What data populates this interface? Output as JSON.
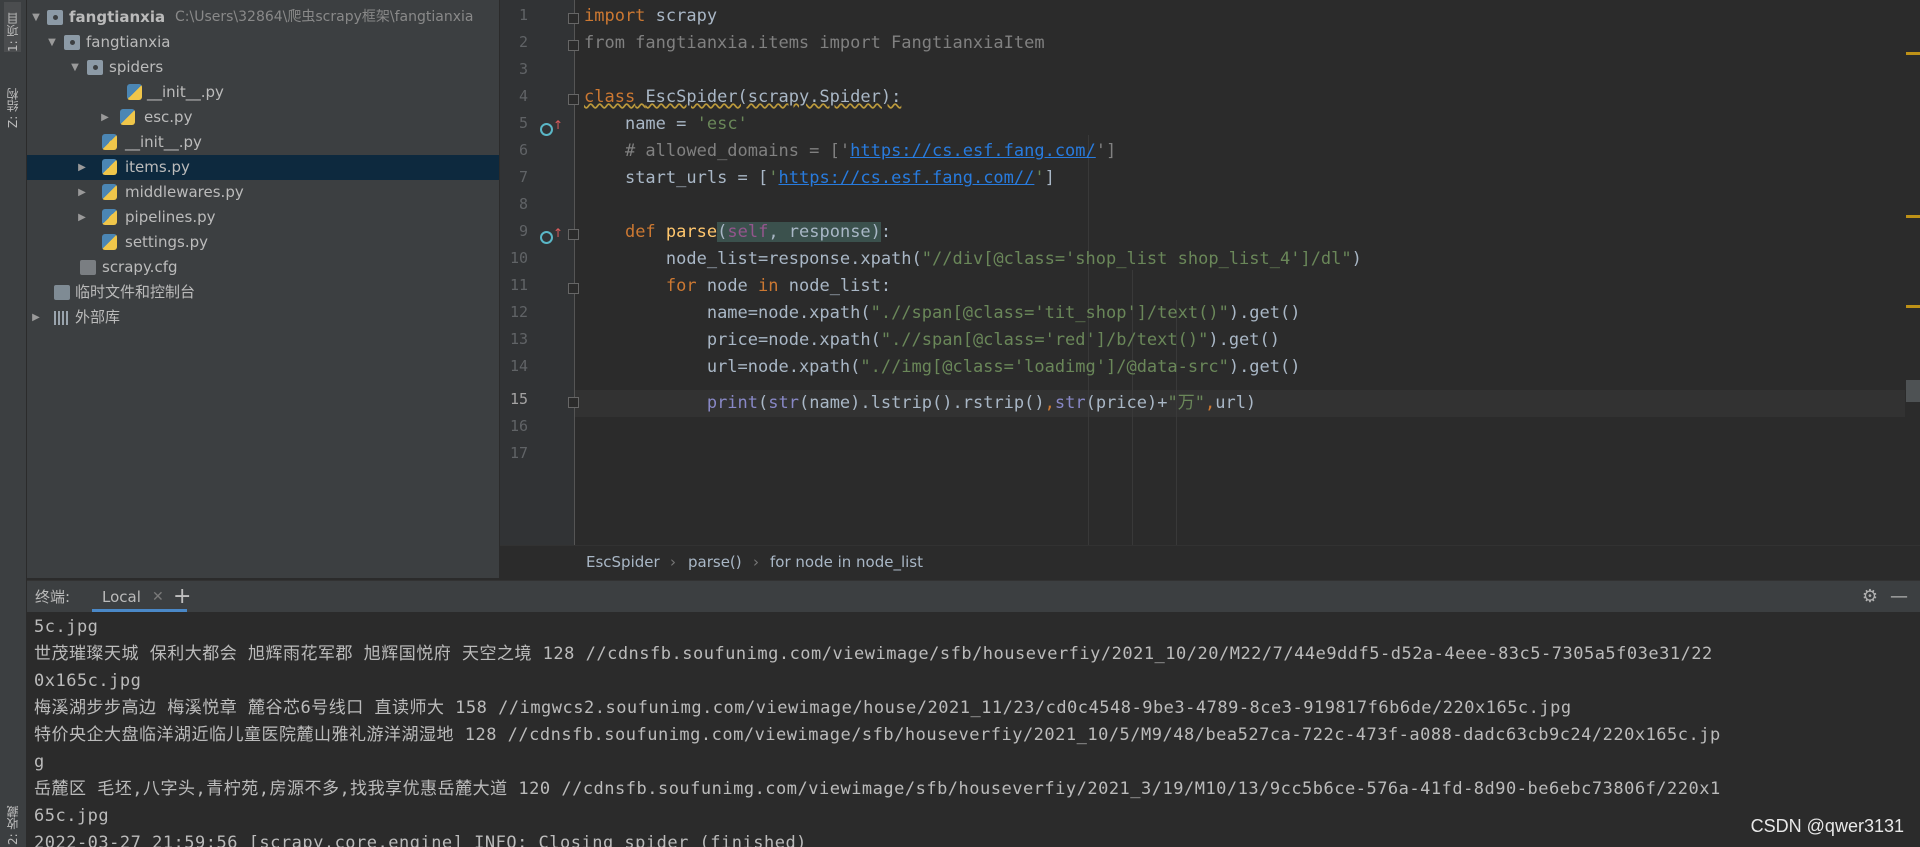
{
  "toolstrip": {
    "project_tab": "1: 项目",
    "structure_tab": "Z: 结构",
    "favorites_tab": "2: 收藏"
  },
  "project": {
    "root": {
      "name": "fangtianxia",
      "path": "C:\\Users\\32864\\爬虫scrapy框架\\fangtianxia"
    },
    "items": [
      {
        "label": "fangtianxia"
      },
      {
        "label": "spiders"
      },
      {
        "label": "__init__.py"
      },
      {
        "label": "esc.py"
      },
      {
        "label": "__init__.py"
      },
      {
        "label": "items.py"
      },
      {
        "label": "middlewares.py"
      },
      {
        "label": "pipelines.py"
      },
      {
        "label": "settings.py"
      },
      {
        "label": "scrapy.cfg"
      },
      {
        "label": "临时文件和控制台"
      },
      {
        "label": "外部库"
      }
    ]
  },
  "editor": {
    "line_numbers": [
      "1",
      "2",
      "3",
      "4",
      "5",
      "6",
      "7",
      "8",
      "9",
      "10",
      "11",
      "12",
      "13",
      "14",
      "15",
      "16",
      "17"
    ],
    "current_line": "15",
    "code": {
      "l1_kw": "import",
      "l1_rest": " scrapy",
      "l2": "from fangtianxia.items import FangtianxiaItem",
      "l4_kw": "class",
      "l4_name": "EscSpider(scrapy.Spider):",
      "l5_a": "name = ",
      "l5_s": "'esc'",
      "l6_a": "# allowed_domains = ['",
      "l6_u": "https://cs.esf.fang.com/",
      "l6_b": "']",
      "l7_a": "start_urls = [",
      "l7_q1": "'",
      "l7_u": "https://cs.esf.fang.com//",
      "l7_q2": "'",
      "l7_b": "]",
      "l9_kw": "def",
      "l9_fn": "parse",
      "l9_p1": "(",
      "l9_self": "self",
      "l9_p2": ", response)",
      "l9_end": ":",
      "l10_a": "node_list=response.xpath(",
      "l10_s": "\"//div[@class='shop_list shop_list_4']/dl\"",
      "l10_b": ")",
      "l11_kw1": "for",
      "l11_a": " node ",
      "l11_kw2": "in",
      "l11_b": " node_list:",
      "l12_a": "name=node.xpath(",
      "l12_s": "\".//span[@class='tit_shop']/text()\"",
      "l12_b": ").get()",
      "l13_a": "price=node.xpath(",
      "l13_s": "\".//span[@class='red']/b/text()\"",
      "l13_b": ").get()",
      "l14_a": "url=node.xpath(",
      "l14_s": "\".//img[@class='loadimg']/@data-src\"",
      "l14_b": ").get()",
      "l15_print": "print",
      "l15_a": "(",
      "l15_str1": "str",
      "l15_b": "(name).lstrip().rstrip()",
      "l15_c1": ",",
      "l15_str2": "str",
      "l15_c": "(price)+",
      "l15_s": "\"万\"",
      "l15_c2": ",",
      "l15_d": "url)"
    },
    "breadcrumb": [
      "EscSpider",
      "parse()",
      "for node in node_list"
    ]
  },
  "terminal": {
    "title": "终端:",
    "tab": "Local",
    "lines": [
      "5c.jpg",
      "世茂璀璨天城 保利大都会 旭辉雨花军郡 旭辉国悦府 天空之境 128 //cdnsfb.soufunimg.com/viewimage/sfb/houseverfiy/2021_10/20/M22/7/44e9ddf5-d52a-4eee-83c5-7305a5f03e31/22",
      "0x165c.jpg",
      "梅溪湖步步高边 梅溪悦章 麓谷芯6号线口 直读师大 158 //imgwcs2.soufunimg.com/viewimage/house/2021_11/23/cd0c4548-9be3-4789-8ce3-919817f6b6de/220x165c.jpg",
      "特价央企大盘临洋湖近临儿童医院麓山雅礼游洋湖湿地 128 //cdnsfb.soufunimg.com/viewimage/sfb/houseverfiy/2021_10/5/M9/48/bea527ca-722c-473f-a088-dadc63cb9c24/220x165c.jp",
      "g",
      "岳麓区 毛坯,八字头,青柠苑,房源不多,找我享优惠岳麓大道 120 //cdnsfb.soufunimg.com/viewimage/sfb/houseverfiy/2021_3/19/M10/13/9cc5b6ce-576a-41fd-8d90-be6ebc73806f/220x1",
      "65c.jpg",
      "2022-03-27 21:59:56 [scrapy.core.engine] INFO: Closing spider (finished)"
    ],
    "watermark": "CSDN @qwer3131"
  }
}
